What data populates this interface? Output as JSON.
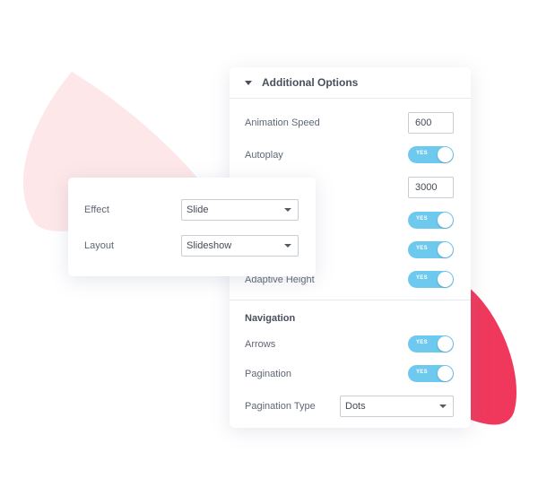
{
  "colors": {
    "accent_toggle": "#6ec9ef",
    "blob_light": "#fde7e8",
    "blob_dark": "#f0385c"
  },
  "additional_options": {
    "title": "Additional Options",
    "caret_icon": "caret-down-icon",
    "animation_speed": {
      "label": "Animation Speed",
      "value": "600"
    },
    "autoplay": {
      "label": "Autoplay",
      "toggle": "YES"
    },
    "speed_value": "3000",
    "toggle_a": "YES",
    "toggle_b": "YES",
    "adaptive_height": {
      "label": "Adaptive Height",
      "toggle": "YES"
    }
  },
  "navigation": {
    "title": "Navigation",
    "arrows": {
      "label": "Arrows",
      "toggle": "YES"
    },
    "pagination": {
      "label": "Pagination",
      "toggle": "YES"
    },
    "pagination_type": {
      "label": "Pagination Type",
      "value": "Dots"
    }
  },
  "effect_card": {
    "effect": {
      "label": "Effect",
      "value": "Slide"
    },
    "layout": {
      "label": "Layout",
      "value": "Slideshow"
    }
  }
}
